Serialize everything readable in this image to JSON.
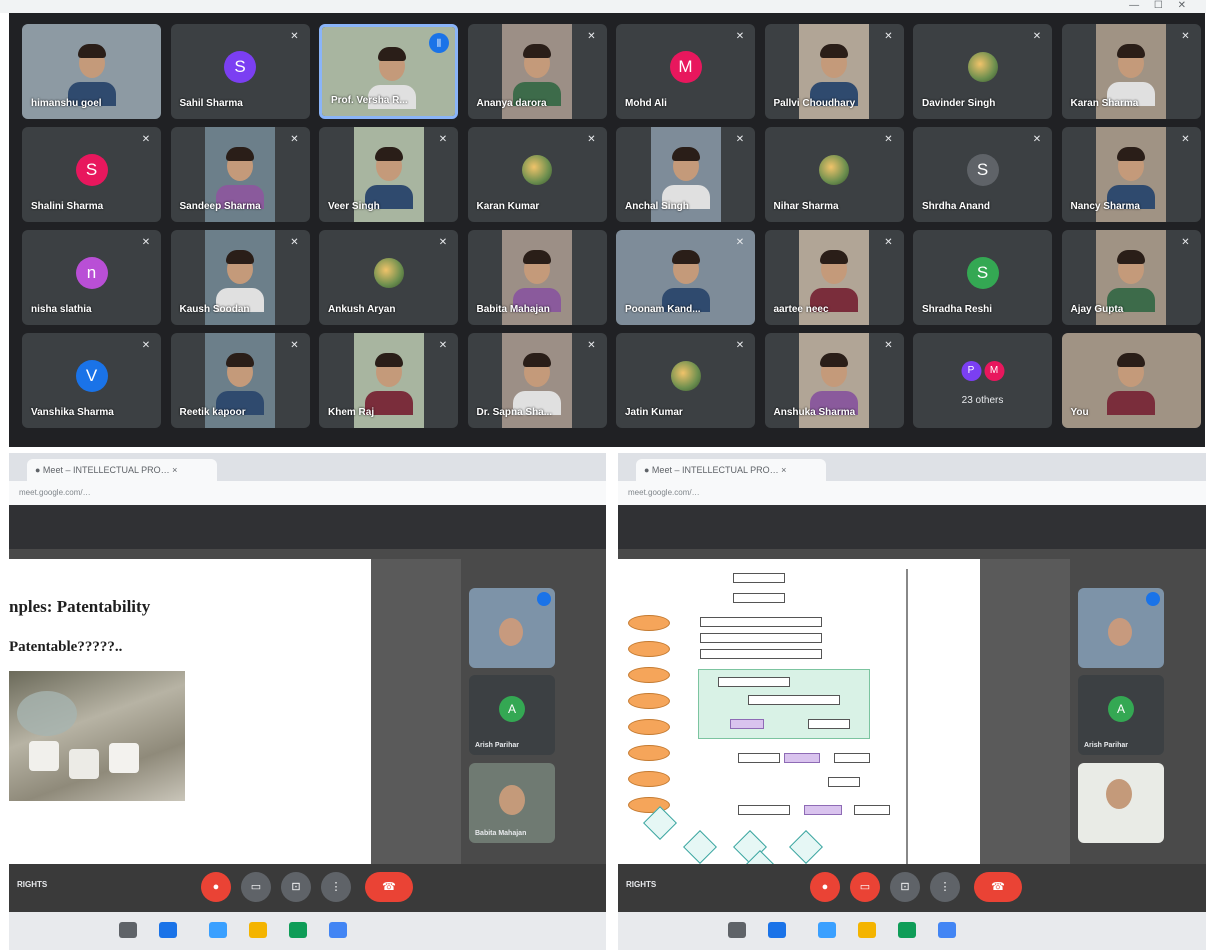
{
  "meeting_grid": {
    "participants": [
      {
        "name": "himanshu goel",
        "type": "video",
        "muted": false
      },
      {
        "name": "Sahil Sharma",
        "type": "avatar",
        "initial": "S",
        "color": "#7b3ff2",
        "muted": true
      },
      {
        "name": "Prof. Versha R...",
        "type": "video",
        "muted": false,
        "speaking": true
      },
      {
        "name": "Ananya darora",
        "type": "video",
        "muted": true
      },
      {
        "name": "Mohd Ali",
        "type": "avatar",
        "initial": "M",
        "color": "#e8175d",
        "muted": true
      },
      {
        "name": "Pallvi Choudhary",
        "type": "video",
        "muted": true
      },
      {
        "name": "Davinder Singh",
        "type": "image-avatar",
        "muted": true
      },
      {
        "name": "Karan Sharma",
        "type": "video",
        "muted": true
      },
      {
        "name": "Shalini Sharma",
        "type": "avatar",
        "initial": "S",
        "color": "#e8175d",
        "muted": true
      },
      {
        "name": "Sandeep Sharma",
        "type": "video",
        "muted": true
      },
      {
        "name": "Veer Singh",
        "type": "video",
        "muted": true
      },
      {
        "name": "Karan Kumar",
        "type": "image-avatar",
        "muted": true
      },
      {
        "name": "Anchal Singh",
        "type": "video",
        "muted": true
      },
      {
        "name": "Nihar Sharma",
        "type": "image-avatar",
        "muted": true
      },
      {
        "name": "Shrdha Anand",
        "type": "avatar",
        "initial": "S",
        "color": "#5f6368",
        "muted": true
      },
      {
        "name": "Nancy Sharma",
        "type": "video",
        "muted": true
      },
      {
        "name": "nisha slathia",
        "type": "avatar",
        "initial": "n",
        "color": "#b94fd6",
        "muted": true
      },
      {
        "name": "Kaush Soodan",
        "type": "video",
        "muted": true
      },
      {
        "name": "Ankush Aryan",
        "type": "image-avatar",
        "muted": true
      },
      {
        "name": "Babita Mahajan",
        "type": "video",
        "muted": false
      },
      {
        "name": "Poonam Kand...",
        "type": "video",
        "muted": true
      },
      {
        "name": "aartee neec",
        "type": "video",
        "muted": true
      },
      {
        "name": "Shradha Reshi",
        "type": "avatar",
        "initial": "S",
        "color": "#34a853",
        "muted": false
      },
      {
        "name": "Ajay Gupta",
        "type": "video",
        "muted": true
      },
      {
        "name": "Vanshika Sharma",
        "type": "avatar",
        "initial": "V",
        "color": "#1a73e8",
        "muted": true
      },
      {
        "name": "Reetik kapoor",
        "type": "video",
        "muted": true
      },
      {
        "name": "Khem Raj",
        "type": "video",
        "muted": true
      },
      {
        "name": "Dr. Sapna Sha...",
        "type": "video",
        "muted": true
      },
      {
        "name": "Jatin Kumar",
        "type": "image-avatar",
        "muted": true
      },
      {
        "name": "Anshuka Sharma",
        "type": "video",
        "muted": true
      },
      {
        "name": "23 others",
        "type": "others",
        "initials": [
          "P",
          "M"
        ]
      },
      {
        "name": "You",
        "type": "video",
        "muted": false
      }
    ]
  },
  "left_share": {
    "slide_title_1": "nples: Patentability",
    "slide_title_2": "Patentable?????..",
    "tile_names": [
      "Arish Parihar",
      "Babita Mahajan"
    ],
    "tile_initial": "A",
    "bottom_label": "RIGHTS"
  },
  "right_share": {
    "tile_names": [
      "Arish Parihar"
    ],
    "tile_initial": "A",
    "bottom_label": "RIGHTS"
  }
}
